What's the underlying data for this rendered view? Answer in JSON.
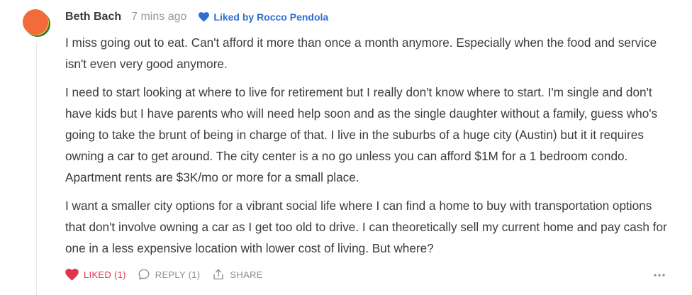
{
  "comment": {
    "author": "Beth Bach",
    "time": "7 mins ago",
    "liked_by": "Liked by Rocco Pendola",
    "paragraphs": [
      "I miss going out to eat. Can't afford it more than once a month anymore. Especially when the food and service isn't even very good anymore.",
      "I need to start looking at where to live for retirement but I really don't know where to start. I'm single and don't have kids but I have parents who will need help soon and as the single daughter without a family, guess who's going to take the brunt of being in charge of that. I live in the suburbs of a huge city (Austin) but it it requires owning a car to get around. The city center is a no go unless you can afford $1M for a 1 bedroom condo. Apartment rents are $3K/mo or more for a small place.",
      "I want a smaller city options for a vibrant social life where I can find a home to buy with transportation options that don't involve owning a car as I get too old to drive. I can theoretically sell my current home and pay cash for one in a less expensive location with lower cost of living. But where?"
    ]
  },
  "actions": {
    "like_label": "LIKED (1)",
    "reply_label": "REPLY (1)",
    "share_label": "SHARE"
  },
  "icons": {
    "avatar": "avatar-orange-circle",
    "liked_by": "heart-icon",
    "like": "heart-icon",
    "reply": "speech-bubble-icon",
    "share": "share-icon",
    "more": "ellipsis-icon"
  },
  "colors": {
    "liked_by": "#2f6fd0",
    "liked": "#e0334f",
    "muted": "#8c8c8c",
    "avatar_primary": "#f26b3a",
    "avatar_secondary": "#2a7a3a"
  }
}
